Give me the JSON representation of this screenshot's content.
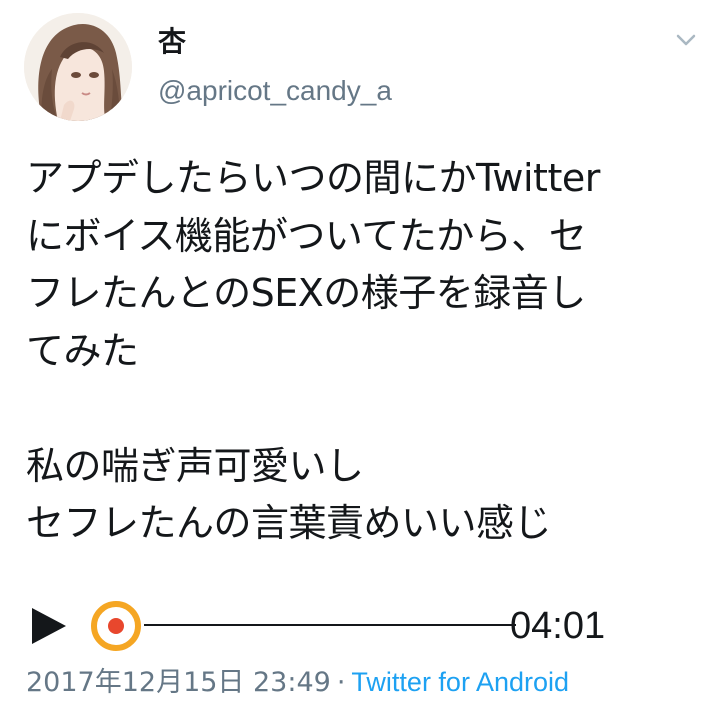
{
  "author": {
    "display_name": "杏",
    "handle": "@apricot_candy_a"
  },
  "tweet": {
    "lines": [
      "アプデしたらいつの間にかTwitter",
      "にボイス機能がついてたから、セ",
      "フレたんとのSEXの様子を録音し",
      "てみた",
      "",
      "私の喘ぎ声可愛いし",
      "セフレたんの言葉責めいい感じ"
    ]
  },
  "player": {
    "duration": "04:01",
    "progress": 0
  },
  "meta": {
    "timestamp": "2017年12月15日 23:49",
    "separator": "·",
    "source": "Twitter for Android"
  },
  "colors": {
    "text": "#14171a",
    "secondary": "#657786",
    "link": "#1da1f2",
    "scrub_orange": "#f5a623",
    "scrub_red": "#e8472d"
  },
  "icons": {
    "menu": "chevron-down-icon",
    "play": "play-icon",
    "scrub": "scrub-knob-icon"
  }
}
